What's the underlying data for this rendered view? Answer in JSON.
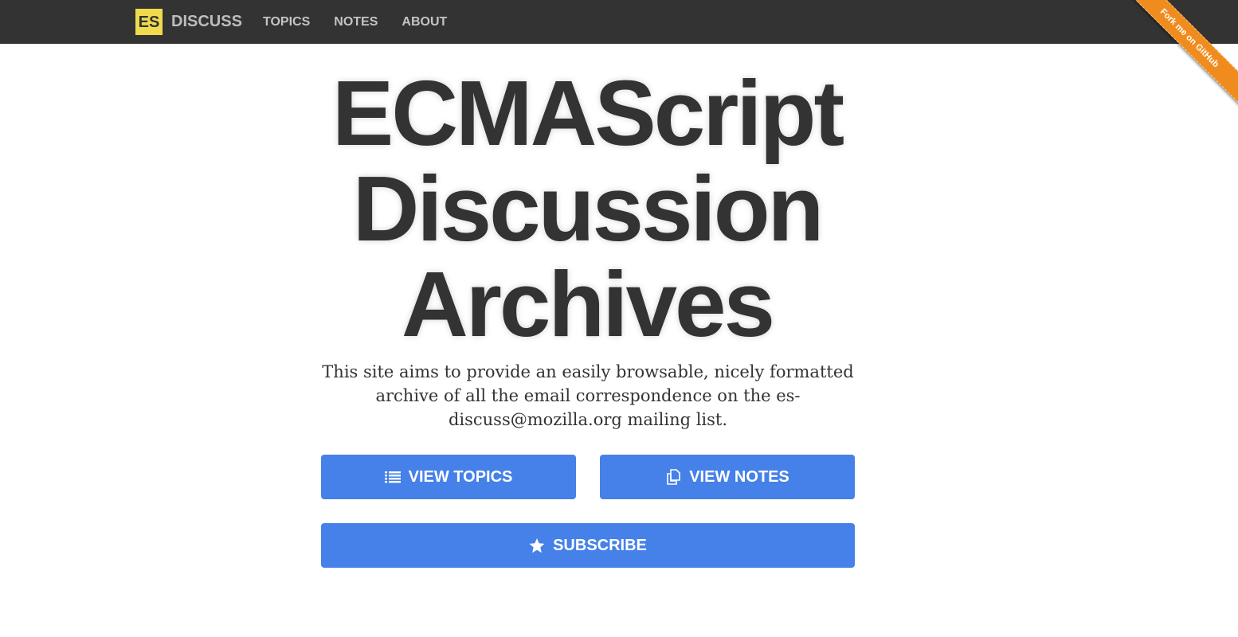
{
  "navbar": {
    "brand_logo": "ES",
    "brand_text": "DISCUSS",
    "links": [
      "TOPICS",
      "NOTES",
      "ABOUT"
    ]
  },
  "ribbon": {
    "label": "Fork me on GitHub",
    "color": "#f08c1e"
  },
  "hero": {
    "title_lines": [
      "ECMAScript",
      "Discussion",
      "Archives"
    ],
    "description": "This site aims to provide an easily browsable, nicely formatted archive of all the email correspondence on the es-discuss@mozilla.org mailing list."
  },
  "buttons": {
    "view_topics": {
      "label": "VIEW TOPICS",
      "icon": "list-icon"
    },
    "view_notes": {
      "label": "VIEW NOTES",
      "icon": "copy-icon"
    },
    "subscribe": {
      "label": "SUBSCRIBE",
      "icon": "star-icon"
    }
  },
  "colors": {
    "navbar_bg": "#333333",
    "logo_bg": "#f0db4f",
    "button_bg": "#4581e8",
    "text": "#333333"
  }
}
